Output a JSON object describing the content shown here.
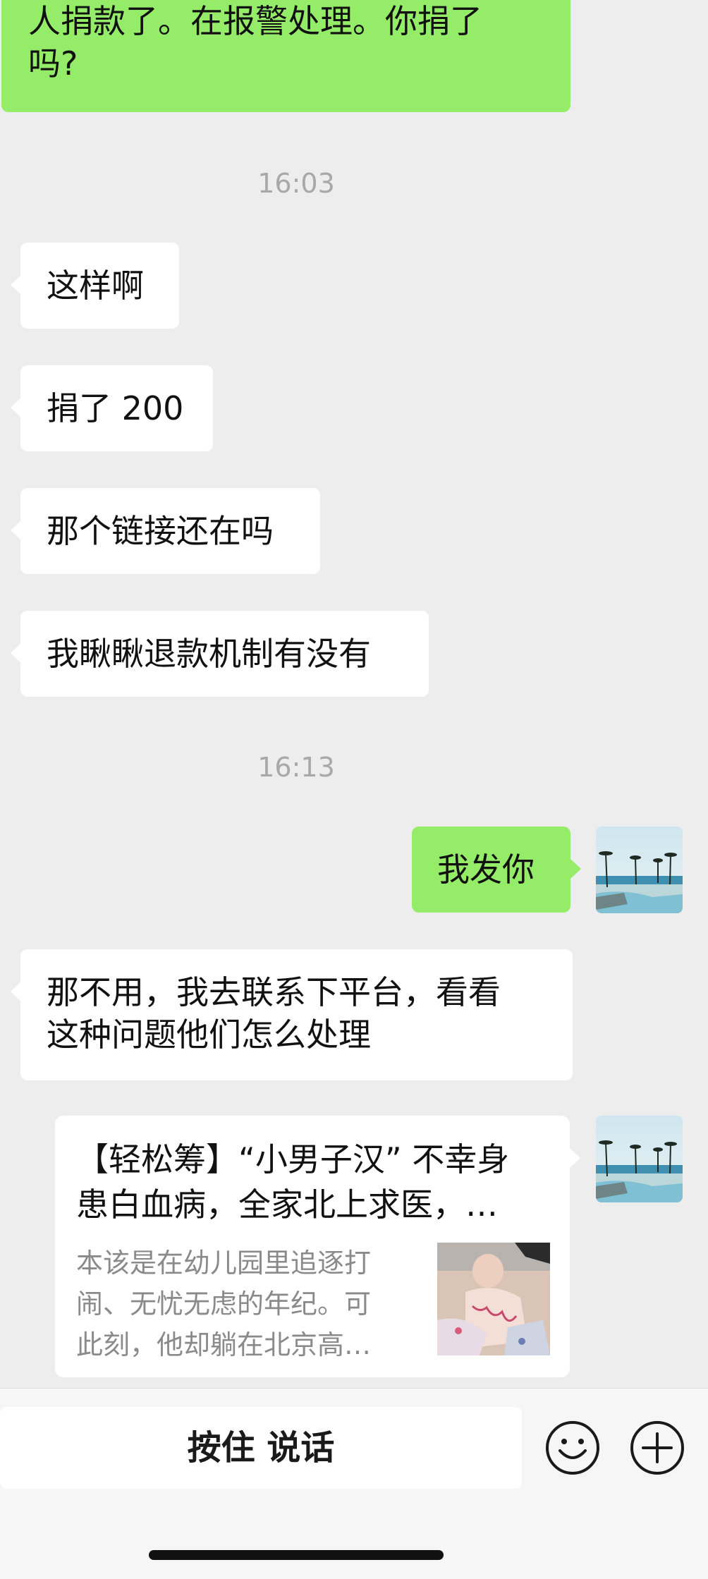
{
  "messages": [
    {
      "side": "out",
      "text_line1": "人捐款了。在报警处理。你捐了",
      "text_line2": "吗?"
    },
    {
      "side": "in",
      "text": "这样啊"
    },
    {
      "side": "in",
      "text": "捐了 200"
    },
    {
      "side": "in",
      "text": "那个链接还在吗"
    },
    {
      "side": "in",
      "text": "我瞅瞅退款机制有没有"
    },
    {
      "side": "out",
      "text": "我发你"
    },
    {
      "side": "in",
      "text_line1": "那不用，我去联系下平台，看看",
      "text_line2": "这种问题他们怎么处理"
    }
  ],
  "timestamps": [
    "16:03",
    "16:13"
  ],
  "link_card": {
    "title_line1": "【轻松筹】“小男子汉” 不幸身",
    "title_line2": "患白血病，全家北上求医，…",
    "desc_line1": "本该是在幼儿园里追逐打",
    "desc_line2": "闹、无忧无虑的年纪。可",
    "desc_line3": "此刻，他却躺在北京高…"
  },
  "input_bar": {
    "hold_to_talk_label": "按住 说话",
    "emoji_icon": "emoji-icon",
    "plus_icon": "plus-icon"
  },
  "colors": {
    "chat_bg": "#ededed",
    "bubble_in": "#ffffff",
    "bubble_out": "#95ec69",
    "timestamp": "#a8a8a8"
  }
}
